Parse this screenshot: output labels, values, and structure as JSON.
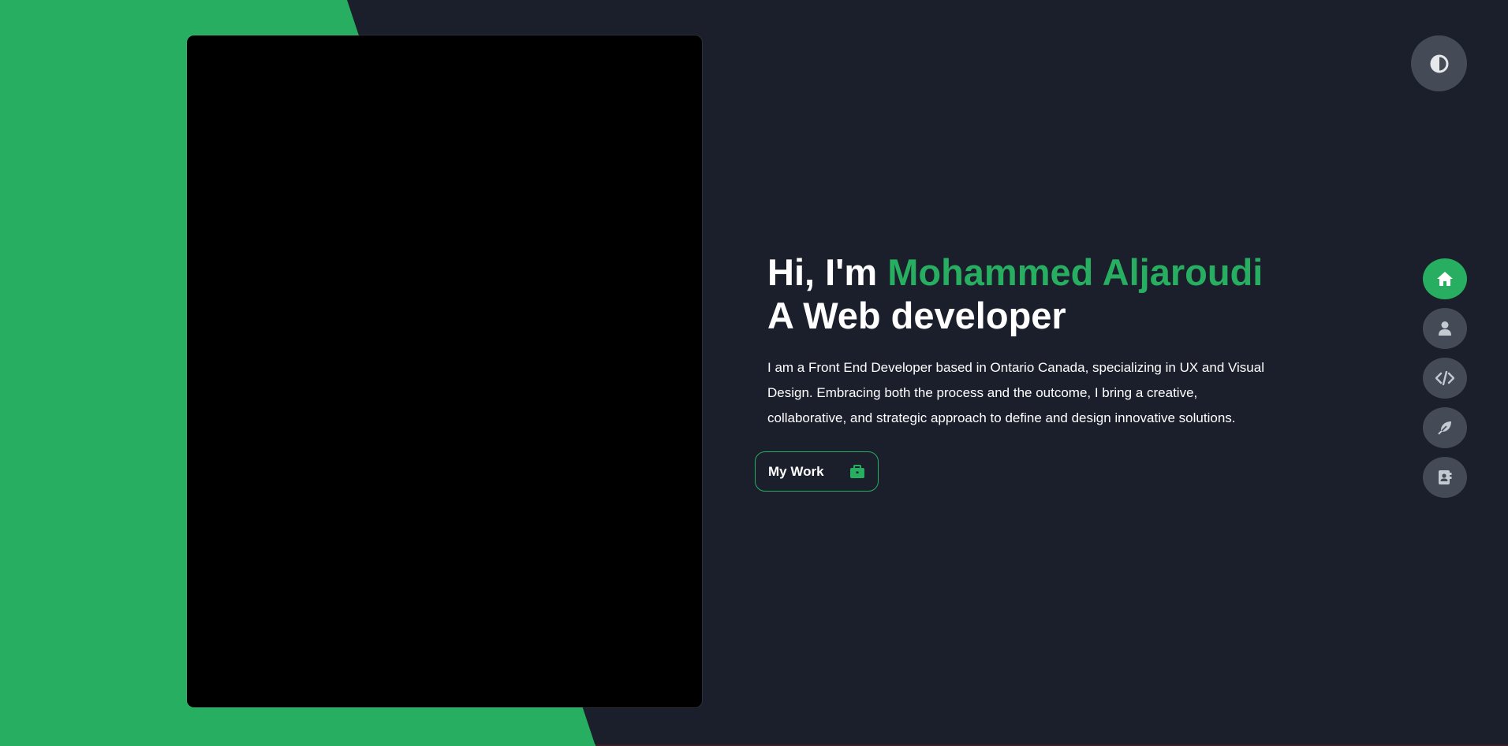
{
  "colors": {
    "background": "#1b1e2b",
    "accent": "#27ae60",
    "button_gray": "#454b56",
    "text": "#ffffff"
  },
  "theme_toggle": {
    "icon": "half-circle-contrast-icon"
  },
  "hero": {
    "greeting": "Hi, I'm ",
    "name": "Mohammed Aljaroudi",
    "role": "A Web developer",
    "description": "I am a Front End Developer based in Ontario Canada, specializing in UX and Visual Design. Embracing both the process and the outcome, I bring a creative, collaborative, and strategic approach to define and design innovative solutions.",
    "button_label": "My Work",
    "button_icon": "briefcase-icon"
  },
  "side_nav": [
    {
      "icon": "home-icon",
      "active": true
    },
    {
      "icon": "user-icon",
      "active": false
    },
    {
      "icon": "code-icon",
      "active": false
    },
    {
      "icon": "feather-icon",
      "active": false
    },
    {
      "icon": "contact-book-icon",
      "active": false
    }
  ]
}
